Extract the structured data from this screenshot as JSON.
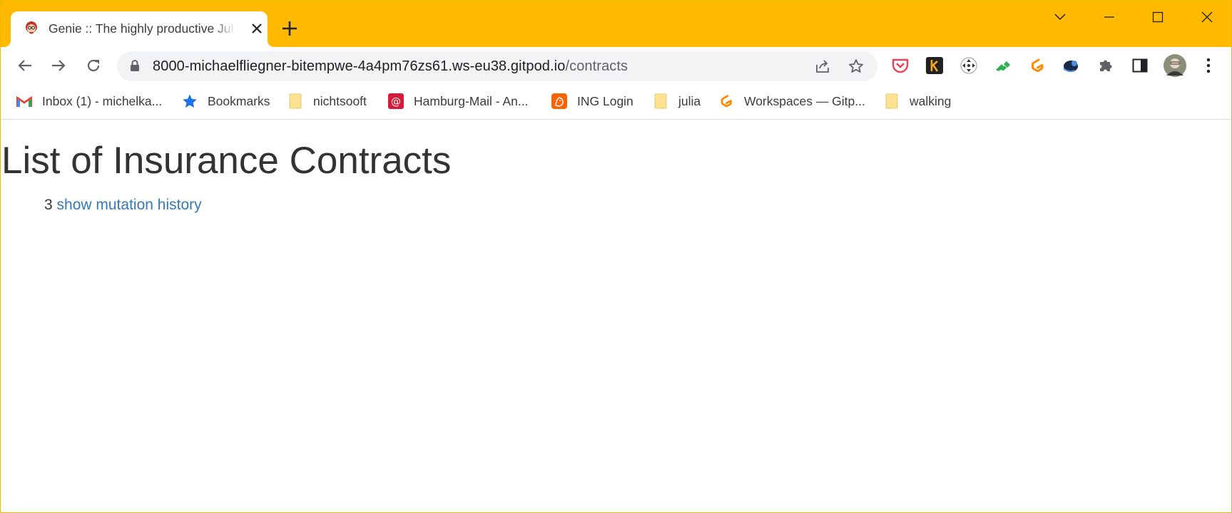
{
  "browser": {
    "tab": {
      "title": "Genie :: The highly productive Julia web framework",
      "favicon": "genie-icon"
    },
    "address_bar": {
      "url_host": "8000-michaelfliegner-bitempwe-4a4pm76zs61.ws-eu38.gitpod.io",
      "url_path": "/contracts"
    },
    "extensions": [
      "pocket-icon",
      "k-extension-icon",
      "move-extension-icon",
      "feedly-icon",
      "gitpod-icon",
      "bird-extension-icon",
      "puzzle-icon",
      "side-panel-icon",
      "profile-avatar",
      "menu-icon"
    ],
    "bookmarks": [
      {
        "label": "Inbox (1) - michelka...",
        "icon": "gmail-icon"
      },
      {
        "label": "Bookmarks",
        "icon": "star-icon"
      },
      {
        "label": "nichtsooft",
        "icon": "folder-icon"
      },
      {
        "label": "Hamburg-Mail - An...",
        "icon": "mail-icon"
      },
      {
        "label": "ING Login",
        "icon": "ing-icon"
      },
      {
        "label": "julia",
        "icon": "folder-icon"
      },
      {
        "label": "Workspaces — Gitp...",
        "icon": "gitpod-icon"
      },
      {
        "label": "walking",
        "icon": "folder-icon"
      }
    ],
    "colors": {
      "frame": "#ffba00",
      "link": "#337ab7"
    }
  },
  "page": {
    "heading": "List of Insurance Contracts",
    "contract_id": "3",
    "history_link": "show mutation history"
  }
}
